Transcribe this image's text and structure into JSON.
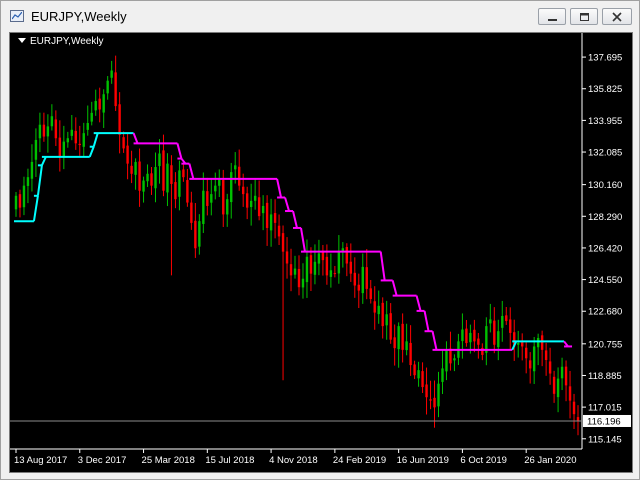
{
  "window": {
    "title": "EURJPY,Weekly",
    "icon": "chart-window-icon",
    "buttons": [
      "minimize-icon",
      "maximize-icon",
      "close-icon"
    ]
  },
  "chart": {
    "symbol_label": "EURJPY,Weekly",
    "colors": {
      "background": "#000000",
      "bull": "#00c000",
      "bear": "#ff0000",
      "trail_up": "#00ffff",
      "trail_down": "#ff00ff",
      "axis": "#ffffff",
      "hline": "#8c8c8c"
    },
    "current_price": "116.196",
    "current_price_value": 116.196
  },
  "chart_data": {
    "type": "candlestick",
    "y_ticks": [
      {
        "v": 137.695,
        "label": "137.695"
      },
      {
        "v": 135.825,
        "label": "135.825"
      },
      {
        "v": 133.955,
        "label": "133.955"
      },
      {
        "v": 132.085,
        "label": "132.085"
      },
      {
        "v": 130.16,
        "label": "130.160"
      },
      {
        "v": 128.29,
        "label": "128.290"
      },
      {
        "v": 126.42,
        "label": "126.420"
      },
      {
        "v": 124.55,
        "label": "124.550"
      },
      {
        "v": 122.68,
        "label": "122.680"
      },
      {
        "v": 120.755,
        "label": "120.755"
      },
      {
        "v": 118.885,
        "label": "118.885"
      },
      {
        "v": 117.015,
        "label": "117.015"
      },
      {
        "v": 115.145,
        "label": "115.145"
      }
    ],
    "ylim": [
      114.6,
      139.0
    ],
    "x_labels": [
      {
        "i": 0,
        "label": "13 Aug 2017"
      },
      {
        "i": 16,
        "label": "3 Dec 2017"
      },
      {
        "i": 32,
        "label": "25 Mar 2018"
      },
      {
        "i": 48,
        "label": "15 Jul 2018"
      },
      {
        "i": 64,
        "label": "4 Nov 2018"
      },
      {
        "i": 80,
        "label": "24 Feb 2019"
      },
      {
        "i": 96,
        "label": "16 Jun 2019"
      },
      {
        "i": 112,
        "label": "6 Oct 2019"
      },
      {
        "i": 128,
        "label": "26 Jan 2020"
      }
    ],
    "closes": [
      129.5,
      128.8,
      130.1,
      130.6,
      131.5,
      132.8,
      133.7,
      133.0,
      133.6,
      134.2,
      132.9,
      131.8,
      132.7,
      132.9,
      133.4,
      132.6,
      132.5,
      133.2,
      133.8,
      134.4,
      135.1,
      134.6,
      135.5,
      136.3,
      136.9,
      134.8,
      133.1,
      132.3,
      131.4,
      130.8,
      131.5,
      129.8,
      130.4,
      130.8,
      130.1,
      131.2,
      132.0,
      129.8,
      131.4,
      130.2,
      129.3,
      131.0,
      130.6,
      129.1,
      127.9,
      126.4,
      128.0,
      129.8,
      128.9,
      129.6,
      130.1,
      130.5,
      128.4,
      129.3,
      130.9,
      131.3,
      130.1,
      129.6,
      128.8,
      129.2,
      129.5,
      128.3,
      128.9,
      127.6,
      128.4,
      127.9,
      127.1,
      126.2,
      125.5,
      124.8,
      125.2,
      124.1,
      124.6,
      125.9,
      124.9,
      125.6,
      126.1,
      125.7,
      124.8,
      125.1,
      124.9,
      126.2,
      126.4,
      125.5,
      124.9,
      124.2,
      123.9,
      125.3,
      124.0,
      123.4,
      122.6,
      123.0,
      121.8,
      122.5,
      121.0,
      120.5,
      121.8,
      120.4,
      120.9,
      119.5,
      118.9,
      119.2,
      118.2,
      117.6,
      117.4,
      117.0,
      118.4,
      119.3,
      120.4,
      119.6,
      119.9,
      120.9,
      121.6,
      120.8,
      121.4,
      120.9,
      120.7,
      120.1,
      121.8,
      122.2,
      120.7,
      121.5,
      122.4,
      122.1,
      121.4,
      120.6,
      120.8,
      120.6,
      119.9,
      119.3,
      120.6,
      121.1,
      120.4,
      119.8,
      119.0,
      117.8,
      118.7,
      119.4,
      118.3,
      117.4,
      116.6,
      116.196
    ],
    "trail": [
      {
        "i0": 0,
        "i1": 4,
        "v": 128.0,
        "dir": "up"
      },
      {
        "i0": 5,
        "i1": 5,
        "v": 129.5,
        "dir": "up"
      },
      {
        "i0": 6,
        "i1": 6,
        "v": 131.3,
        "dir": "up"
      },
      {
        "i0": 7,
        "i1": 18,
        "v": 131.8,
        "dir": "up"
      },
      {
        "i0": 19,
        "i1": 19,
        "v": 132.4,
        "dir": "up"
      },
      {
        "i0": 20,
        "i1": 29,
        "v": 133.2,
        "dir": "up"
      },
      {
        "i0": 30,
        "i1": 40,
        "v": 132.6,
        "dir": "down"
      },
      {
        "i0": 41,
        "i1": 41,
        "v": 131.7,
        "dir": "down"
      },
      {
        "i0": 42,
        "i1": 43,
        "v": 131.4,
        "dir": "down"
      },
      {
        "i0": 44,
        "i1": 65,
        "v": 130.5,
        "dir": "down"
      },
      {
        "i0": 66,
        "i1": 67,
        "v": 129.4,
        "dir": "down"
      },
      {
        "i0": 68,
        "i1": 69,
        "v": 128.6,
        "dir": "down"
      },
      {
        "i0": 70,
        "i1": 71,
        "v": 127.6,
        "dir": "down"
      },
      {
        "i0": 72,
        "i1": 91,
        "v": 126.2,
        "dir": "down"
      },
      {
        "i0": 92,
        "i1": 94,
        "v": 124.5,
        "dir": "down"
      },
      {
        "i0": 95,
        "i1": 100,
        "v": 123.6,
        "dir": "down"
      },
      {
        "i0": 101,
        "i1": 102,
        "v": 122.7,
        "dir": "down"
      },
      {
        "i0": 103,
        "i1": 104,
        "v": 121.5,
        "dir": "down"
      },
      {
        "i0": 105,
        "i1": 124,
        "v": 120.4,
        "dir": "down"
      },
      {
        "i0": 125,
        "i1": 137,
        "v": 120.9,
        "dir": "up"
      },
      {
        "i0": 138,
        "i1": 139,
        "v": 120.6,
        "dir": "down"
      }
    ]
  }
}
